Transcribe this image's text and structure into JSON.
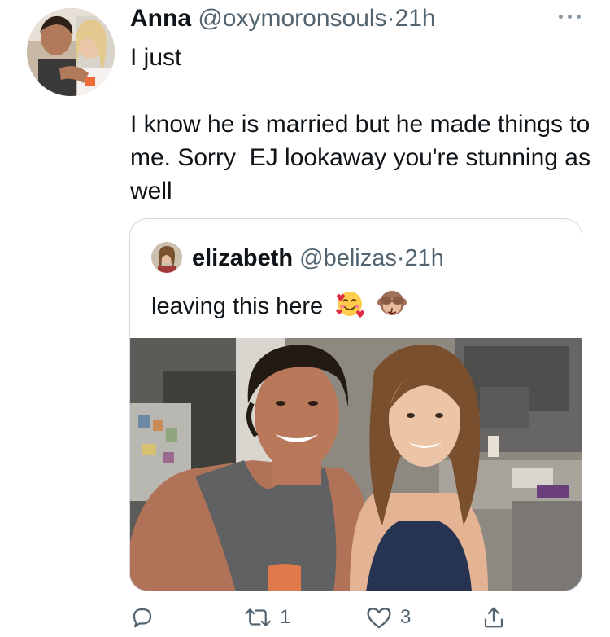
{
  "tweet": {
    "author": {
      "name": "Anna",
      "handle": "@oxymoronsouls",
      "separator": "·",
      "time": "21h"
    },
    "text": "I just\n\nI know he is married but he made things to me. Sorry  EJ lookaway you're stunning as well",
    "quoted": {
      "name": "elizabeth",
      "handle": "@belizas",
      "separator": "·",
      "time": "21h",
      "text": "leaving this here",
      "emojis": [
        "smiling-face-with-hearts",
        "see-no-evil-monkey"
      ]
    },
    "actions": {
      "reply_count": "",
      "retweet_count": "1",
      "like_count": "3"
    }
  },
  "colors": {
    "text": "#0f1419",
    "secondary": "#536471",
    "border": "#cfd9de",
    "icon": "#536471"
  },
  "icons": {
    "more": "more-dots-icon",
    "reply": "reply-bubble-icon",
    "retweet": "retweet-icon",
    "like": "heart-icon",
    "share": "share-icon"
  }
}
